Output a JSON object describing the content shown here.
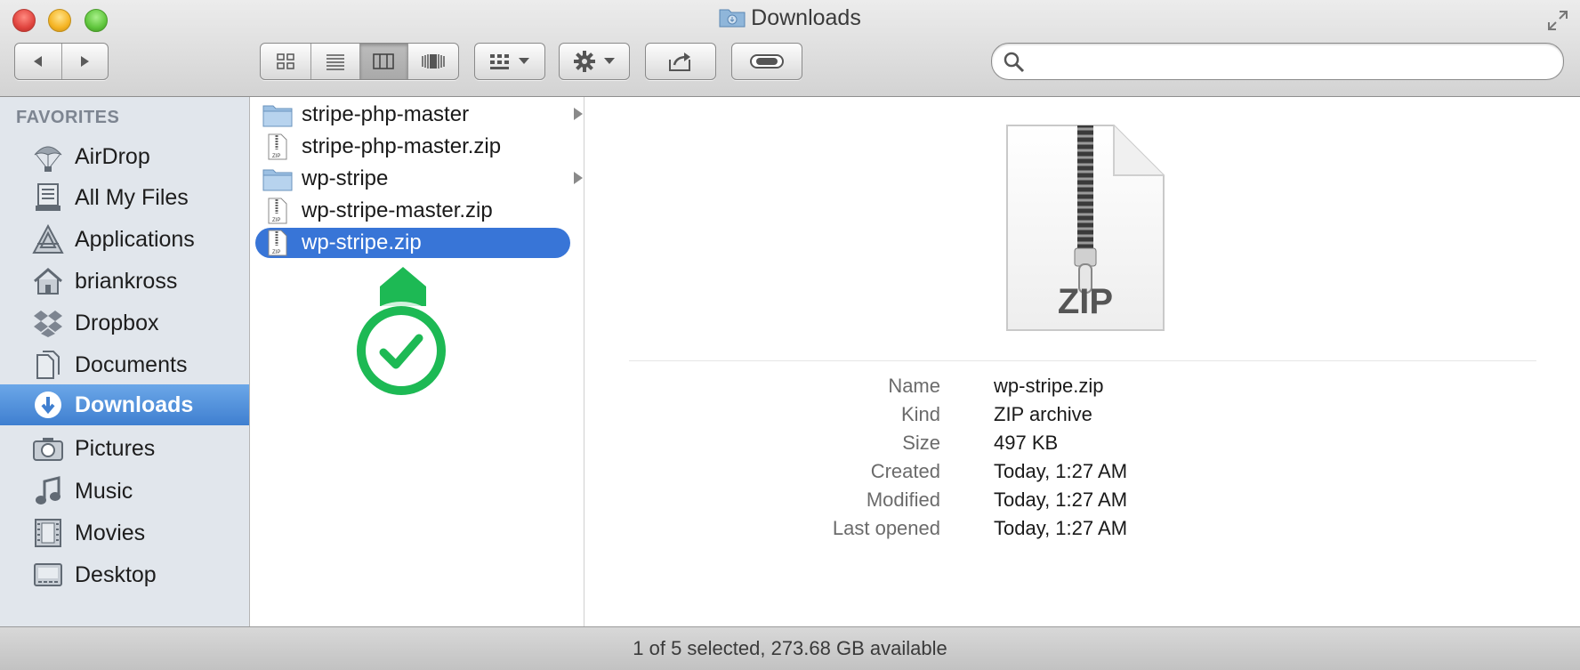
{
  "window": {
    "title": "Downloads"
  },
  "toolbar": {
    "back": "◀",
    "forward": "▶"
  },
  "search": {
    "placeholder": ""
  },
  "sidebar": {
    "header": "FAVORITES",
    "items": [
      {
        "label": "AirDrop",
        "icon": "airdrop-icon"
      },
      {
        "label": "All My Files",
        "icon": "all-files-icon"
      },
      {
        "label": "Applications",
        "icon": "applications-icon"
      },
      {
        "label": "briankross",
        "icon": "home-icon"
      },
      {
        "label": "Dropbox",
        "icon": "dropbox-icon"
      },
      {
        "label": "Documents",
        "icon": "documents-icon"
      },
      {
        "label": "Downloads",
        "icon": "downloads-icon",
        "selected": true
      },
      {
        "label": "Pictures",
        "icon": "camera-icon"
      },
      {
        "label": "Music",
        "icon": "music-icon"
      },
      {
        "label": "Movies",
        "icon": "film-icon"
      },
      {
        "label": "Desktop",
        "icon": "desktop-icon"
      }
    ]
  },
  "files": [
    {
      "name": "stripe-php-master",
      "type": "folder"
    },
    {
      "name": "stripe-php-master.zip",
      "type": "zip"
    },
    {
      "name": "wp-stripe",
      "type": "folder"
    },
    {
      "name": "wp-stripe-master.zip",
      "type": "zip"
    },
    {
      "name": "wp-stripe.zip",
      "type": "zip",
      "selected": true
    }
  ],
  "preview": {
    "icon_label": "ZIP",
    "info": [
      {
        "key": "Name",
        "value": "wp-stripe.zip"
      },
      {
        "key": "Kind",
        "value": "ZIP archive"
      },
      {
        "key": "Size",
        "value": "497 KB"
      },
      {
        "key": "Created",
        "value": "Today, 1:27 AM"
      },
      {
        "key": "Modified",
        "value": "Today, 1:27 AM"
      },
      {
        "key": "Last opened",
        "value": "Today, 1:27 AM"
      }
    ]
  },
  "status": {
    "text": "1 of 5 selected, 273.68 GB available"
  },
  "colors": {
    "selection": "#3875d7",
    "badge": "#1db954",
    "sidebar_bg": "#e1e6ec"
  }
}
